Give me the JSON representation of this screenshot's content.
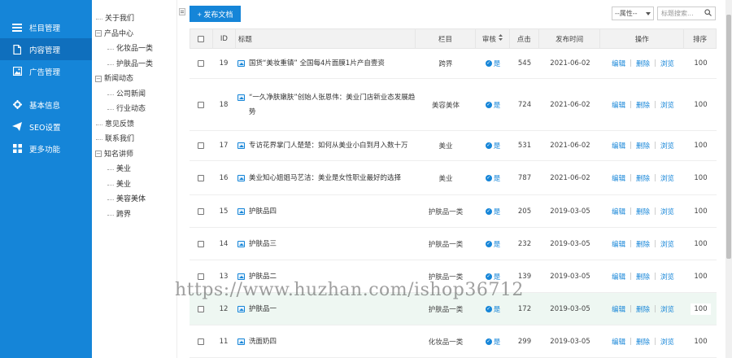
{
  "sidebar": {
    "items": [
      {
        "label": "栏目管理",
        "icon": "list-icon",
        "active": false
      },
      {
        "label": "内容管理",
        "icon": "document-icon",
        "active": true
      },
      {
        "label": "广告管理",
        "icon": "image-icon",
        "active": false
      },
      {
        "label": "基本信息",
        "icon": "gear-icon",
        "active": false
      },
      {
        "label": "SEO设置",
        "icon": "send-icon",
        "active": false
      },
      {
        "label": "更多功能",
        "icon": "grid-icon",
        "active": false
      }
    ]
  },
  "tree": [
    {
      "label": "关于我们",
      "level": 0,
      "expandable": false
    },
    {
      "label": "产品中心",
      "level": 0,
      "expandable": true
    },
    {
      "label": "化妆品一类",
      "level": 1,
      "expandable": false
    },
    {
      "label": "护肤品一类",
      "level": 1,
      "expandable": false
    },
    {
      "label": "新闻动态",
      "level": 0,
      "expandable": true
    },
    {
      "label": "公司新闻",
      "level": 1,
      "expandable": false
    },
    {
      "label": "行业动态",
      "level": 1,
      "expandable": false
    },
    {
      "label": "意见反馈",
      "level": 0,
      "expandable": false
    },
    {
      "label": "联系我们",
      "level": 0,
      "expandable": false
    },
    {
      "label": "知名讲师",
      "level": 0,
      "expandable": true
    },
    {
      "label": "美业",
      "level": 1,
      "expandable": false
    },
    {
      "label": "美业",
      "level": 1,
      "expandable": false
    },
    {
      "label": "美容美体",
      "level": 1,
      "expandable": false
    },
    {
      "label": "跨界",
      "level": 1,
      "expandable": false
    }
  ],
  "toolbar": {
    "publish_label": "+ 发布文档",
    "attr_select": "--属性--",
    "search_placeholder": "标题搜索..."
  },
  "table": {
    "columns": [
      "ID",
      "标题",
      "栏目",
      "审核",
      "点击",
      "发布时间",
      "操作",
      "排序"
    ],
    "rows": [
      {
        "id": "19",
        "title": "国货“美妆重镇” 全国每4片面膜1片产自壹资",
        "column": "跨界",
        "audit": "是",
        "clicks": "545",
        "date": "2021-06-02",
        "sort": "100",
        "height": 37
      },
      {
        "id": "18",
        "title": "“一久净肤嫩肤”创始人张恩伟：美业门店新业态发展趋势",
        "column": "美容美体",
        "audit": "是",
        "clicks": "724",
        "date": "2021-06-02",
        "sort": "100",
        "height": 64
      },
      {
        "id": "17",
        "title": "专访花界掌门人楚楚：如何从美业小白到月入数十万",
        "column": "美业",
        "audit": "是",
        "clicks": "531",
        "date": "2021-06-02",
        "sort": "100",
        "height": 37
      },
      {
        "id": "16",
        "title": "美业知心姐姐马艺洁：美业是女性职业最好的选择",
        "column": "美业",
        "audit": "是",
        "clicks": "787",
        "date": "2021-06-02",
        "sort": "100",
        "height": 42
      },
      {
        "id": "15",
        "title": "护肤品四",
        "column": "护肤品一类",
        "audit": "是",
        "clicks": "205",
        "date": "2019-03-05",
        "sort": "100",
        "height": 40
      },
      {
        "id": "14",
        "title": "护肤品三",
        "column": "护肤品一类",
        "audit": "是",
        "clicks": "232",
        "date": "2019-03-05",
        "sort": "100",
        "height": 40
      },
      {
        "id": "13",
        "title": "护肤品二",
        "column": "护肤品一类",
        "audit": "是",
        "clicks": "139",
        "date": "2019-03-05",
        "sort": "100",
        "height": 40
      },
      {
        "id": "12",
        "title": "护肤品一",
        "column": "护肤品一类",
        "audit": "是",
        "clicks": "172",
        "date": "2019-03-05",
        "sort": "100",
        "height": 40,
        "highlight": true
      },
      {
        "id": "11",
        "title": "洗面奶四",
        "column": "化妆品一类",
        "audit": "是",
        "clicks": "299",
        "date": "2019-03-05",
        "sort": "100",
        "height": 40
      }
    ],
    "actions": [
      "编辑",
      "删除",
      "浏览"
    ]
  },
  "watermark": "https://www.huzhan.com/ishop36712",
  "colors": {
    "accent": "#1585d8",
    "sidebar_active": "#0f6fbd",
    "row_highlight": "#eef7f2"
  }
}
